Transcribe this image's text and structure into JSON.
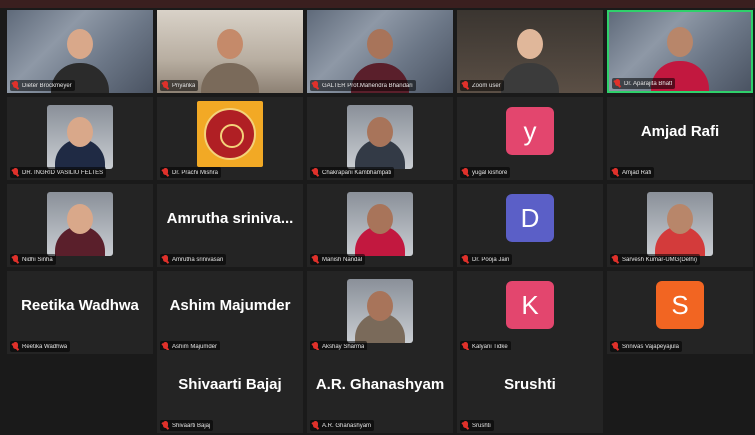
{
  "participants": [
    {
      "name": "Dieter Brockmeyer",
      "display": "video"
    },
    {
      "name": "Priyanka",
      "display": "video"
    },
    {
      "name": "GALTER Prof.Mahendra Bhandari",
      "display": "video"
    },
    {
      "name": "Zoom user",
      "display": "video"
    },
    {
      "name": "Dr. Aparajita Bhatt",
      "display": "video",
      "active_speaker": true
    },
    {
      "name": "DR. INGRID VASILIU FELTES",
      "display": "photo"
    },
    {
      "name": "Dr. Prachi Mishra",
      "display": "logo"
    },
    {
      "name": "Chakrapani Kambhampati",
      "display": "photo"
    },
    {
      "name": "yugal kishore",
      "display": "avatar",
      "initial": "y",
      "color": "#e3466e"
    },
    {
      "name": "Amjad Rafi",
      "display": "name",
      "big_name": "Amjad Rafi"
    },
    {
      "name": "Nidhi Sinha",
      "display": "photo"
    },
    {
      "name": "Amrutha srinivasan",
      "display": "name",
      "big_name": "Amrutha  sriniva..."
    },
    {
      "name": "Manish Nandal",
      "display": "photo"
    },
    {
      "name": "Dr. Pooja Jain",
      "display": "avatar",
      "initial": "D",
      "color": "#5b5fc7"
    },
    {
      "name": "Sarvesh Kumar-UMG(Delhi)",
      "display": "photo"
    },
    {
      "name": "Reetika Wadhwa",
      "display": "name",
      "big_name": "Reetika Wadhwa"
    },
    {
      "name": "Ashim Majumder",
      "display": "name",
      "big_name": "Ashim Majumder"
    },
    {
      "name": "Akshay Sharma",
      "display": "photo"
    },
    {
      "name": "Kalyani Tidke",
      "display": "avatar",
      "initial": "K",
      "color": "#e3466e"
    },
    {
      "name": "Srinivas Vajapeyajula",
      "display": "avatar",
      "initial": "S",
      "color": "#f26522"
    },
    {
      "name": "Shivaarti Bajaj",
      "display": "name",
      "big_name": "Shivaarti Bajaj"
    },
    {
      "name": "A.R. Ghanashyam",
      "display": "name",
      "big_name": "A.R. Ghanashyam"
    },
    {
      "name": "Srushti",
      "display": "name",
      "big_name": "Srushti"
    }
  ],
  "colors": {
    "background": "#1a1a1a",
    "tile": "#242424",
    "active_border": "#2fd06b",
    "muted_mic": "#e0312b"
  }
}
